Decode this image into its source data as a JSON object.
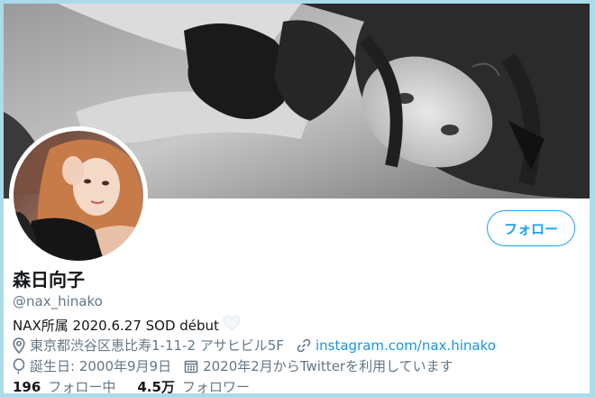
{
  "profile": {
    "display_name": "森日向子",
    "handle": "@nax_hinako",
    "bio": "NAX所属 2020.6.27 SOD début",
    "location": "東京都渋谷区恵比寿1-11-2 アサヒビル5F",
    "website": "instagram.com/nax.hinako",
    "birthday": "誕生日: 2000年9月9日",
    "joined": "2020年2月からTwitterを利用しています"
  },
  "actions": {
    "follow_label": "フォロー"
  },
  "stats": {
    "following_count": "196",
    "following_label": "フォロー中",
    "followers_count": "4.5万",
    "followers_label": "フォロワー"
  },
  "icons": {
    "location": "location-pin-icon",
    "website": "link-icon",
    "birthday": "balloon-icon",
    "joined": "calendar-icon",
    "bio_emoji": "white-heart-icon"
  },
  "colors": {
    "accent": "#1da1f2",
    "link": "#1b95e0",
    "secondary_text": "#657786",
    "primary_text": "#14171a",
    "page_border": "#a9dbea"
  }
}
